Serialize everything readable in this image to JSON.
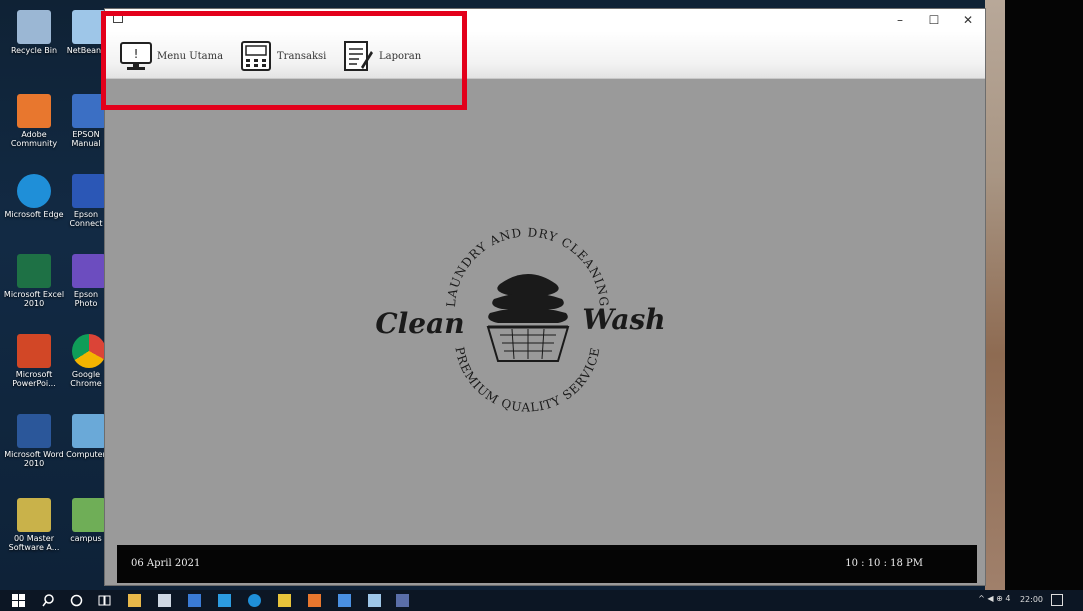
{
  "desktop": {
    "icons": [
      {
        "label": "Recycle Bin",
        "color": "#9bb7d4"
      },
      {
        "label": "NetBeans",
        "color": "#9ec6e8"
      },
      {
        "label": "Adobe Community",
        "color": "#e8772e"
      },
      {
        "label": "EPSON Manual",
        "color": "#3b6fc4"
      },
      {
        "label": "Microsoft Edge",
        "color": "#1f8fd8"
      },
      {
        "label": "Epson Connect",
        "color": "#2b57b6"
      },
      {
        "label": "Microsoft Excel 2010",
        "color": "#1e7145"
      },
      {
        "label": "Epson Photo",
        "color": "#6c4dbf"
      },
      {
        "label": "Microsoft PowerPoi...",
        "color": "#d24726"
      },
      {
        "label": "Google Chrome",
        "color": "#e8c33a"
      },
      {
        "label": "Microsoft Word 2010",
        "color": "#2b579a"
      },
      {
        "label": "Computer",
        "color": "#6aa9d8"
      },
      {
        "label": "00 Master Software A...",
        "color": "#c9b24a"
      },
      {
        "label": "campus",
        "color": "#6fae57"
      }
    ]
  },
  "window": {
    "controls": {
      "minimize": "–",
      "maximize": "☐",
      "close": "✕"
    },
    "menu": [
      {
        "label": "Menu Utama",
        "icon": "monitor-icon"
      },
      {
        "label": "Transaksi",
        "icon": "calculator-icon"
      },
      {
        "label": "Laporan",
        "icon": "report-icon"
      }
    ],
    "logo": {
      "top_text": "LAUNDRY AND DRY CLEANING",
      "left_word": "Clean",
      "right_word": "Wash",
      "bottom_text": "PREMIUM QUALITY SERVICE"
    },
    "status": {
      "date": "06 April 2021",
      "time": "10 : 10 : 18 PM"
    }
  },
  "taskbar": {
    "clock": "22:00",
    "tray": "^ ◀ ⊕ 4 "
  }
}
